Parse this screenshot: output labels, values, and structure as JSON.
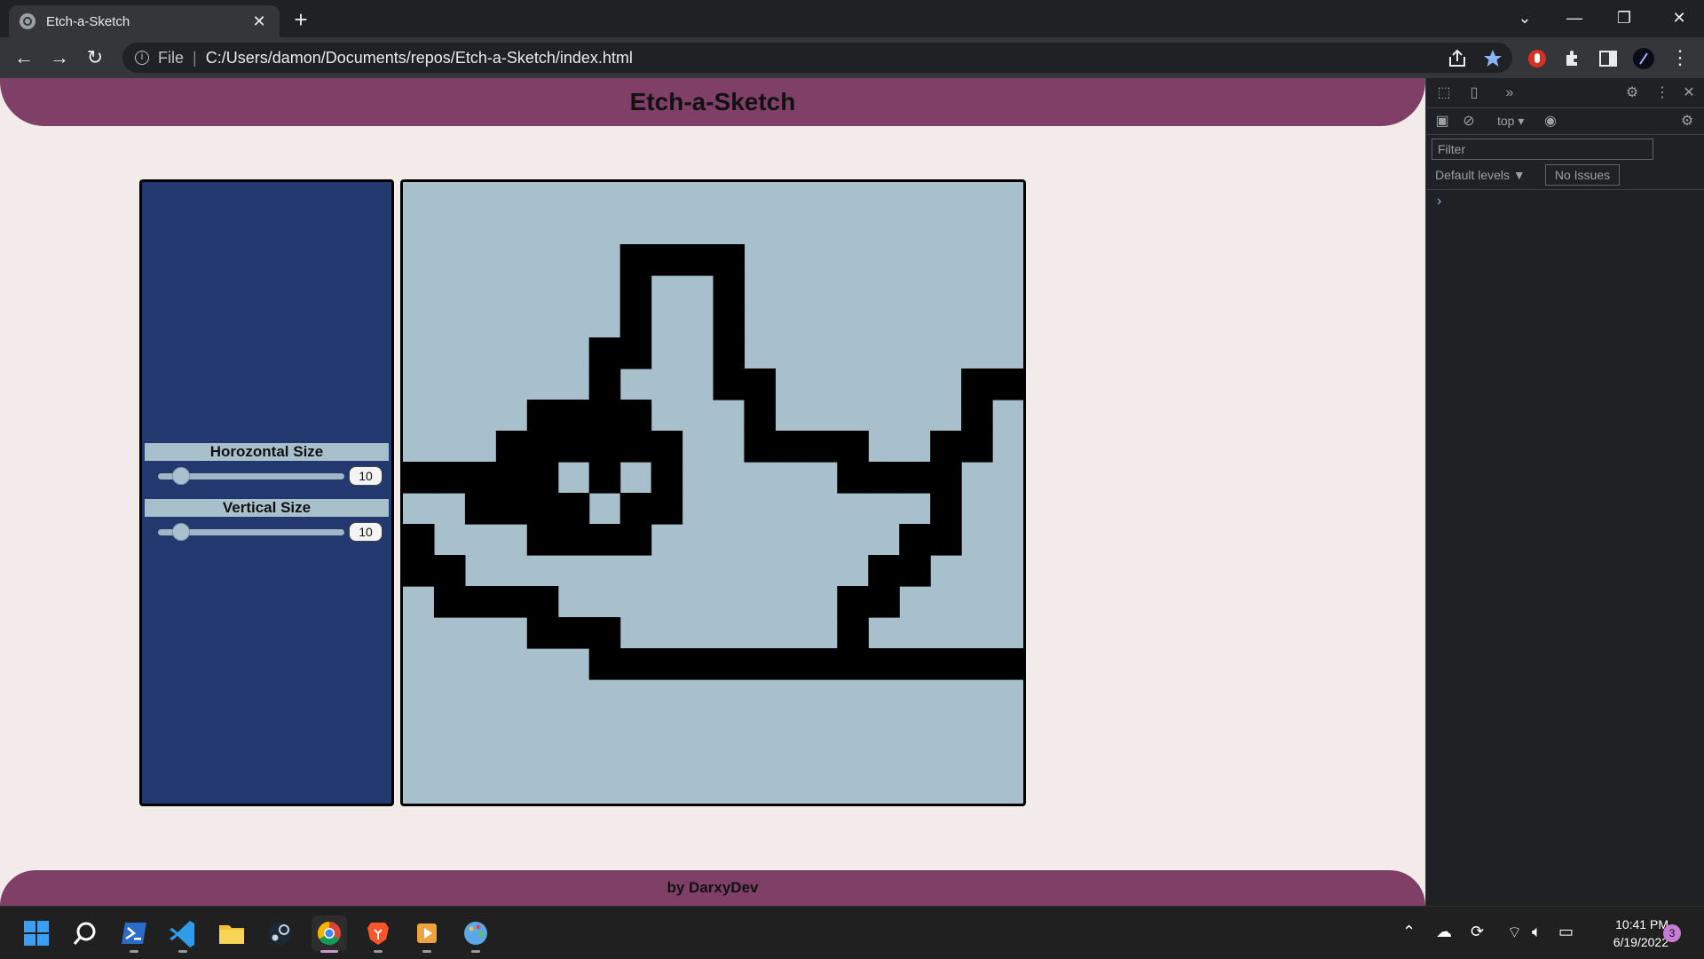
{
  "browser": {
    "tab_title": "Etch-a-Sketch",
    "url_scheme": "File",
    "url_path": "C:/Users/damon/Documents/repos/Etch-a-Sketch/index.html"
  },
  "page": {
    "title": "Etch-a-Sketch",
    "footer": "by DarxyDev",
    "controls": {
      "horizontal_label": "Horozontal Size",
      "horizontal_value": "10",
      "horizontal_fraction": 0.05,
      "vertical_label": "Vertical Size",
      "vertical_value": "10",
      "vertical_fraction": 0.05
    },
    "drawing": {
      "columns": 20,
      "rows": 20,
      "cell_color": "#000000",
      "background_color": "#a8bfcc",
      "filled_cells": [
        [
          7,
          2
        ],
        [
          8,
          2
        ],
        [
          9,
          2
        ],
        [
          10,
          2
        ],
        [
          7,
          3
        ],
        [
          10,
          3
        ],
        [
          7,
          4
        ],
        [
          10,
          4
        ],
        [
          6,
          5
        ],
        [
          7,
          5
        ],
        [
          10,
          5
        ],
        [
          6,
          6
        ],
        [
          10,
          6
        ],
        [
          11,
          6
        ],
        [
          18,
          6
        ],
        [
          19,
          6
        ],
        [
          4,
          7
        ],
        [
          5,
          7
        ],
        [
          6,
          7
        ],
        [
          7,
          7
        ],
        [
          11,
          7
        ],
        [
          18,
          7
        ],
        [
          3,
          8
        ],
        [
          4,
          8
        ],
        [
          5,
          8
        ],
        [
          6,
          8
        ],
        [
          7,
          8
        ],
        [
          8,
          8
        ],
        [
          11,
          8
        ],
        [
          12,
          8
        ],
        [
          13,
          8
        ],
        [
          14,
          8
        ],
        [
          17,
          8
        ],
        [
          18,
          8
        ],
        [
          0,
          9
        ],
        [
          1,
          9
        ],
        [
          2,
          9
        ],
        [
          3,
          9
        ],
        [
          4,
          9
        ],
        [
          6,
          9
        ],
        [
          8,
          9
        ],
        [
          14,
          9
        ],
        [
          15,
          9
        ],
        [
          16,
          9
        ],
        [
          17,
          9
        ],
        [
          2,
          10
        ],
        [
          3,
          10
        ],
        [
          4,
          10
        ],
        [
          5,
          10
        ],
        [
          7,
          10
        ],
        [
          8,
          10
        ],
        [
          17,
          10
        ],
        [
          0,
          11
        ],
        [
          4,
          11
        ],
        [
          5,
          11
        ],
        [
          6,
          11
        ],
        [
          7,
          11
        ],
        [
          16,
          11
        ],
        [
          17,
          11
        ],
        [
          0,
          12
        ],
        [
          1,
          12
        ],
        [
          15,
          12
        ],
        [
          16,
          12
        ],
        [
          1,
          13
        ],
        [
          2,
          13
        ],
        [
          3,
          13
        ],
        [
          4,
          13
        ],
        [
          14,
          13
        ],
        [
          15,
          13
        ],
        [
          4,
          14
        ],
        [
          5,
          14
        ],
        [
          6,
          14
        ],
        [
          14,
          14
        ],
        [
          6,
          15
        ],
        [
          7,
          15
        ],
        [
          8,
          15
        ],
        [
          9,
          15
        ],
        [
          10,
          15
        ],
        [
          11,
          15
        ],
        [
          12,
          15
        ],
        [
          13,
          15
        ],
        [
          14,
          15
        ],
        [
          15,
          15
        ],
        [
          16,
          15
        ],
        [
          17,
          15
        ],
        [
          18,
          15
        ],
        [
          19,
          15
        ]
      ]
    }
  },
  "devtools": {
    "context": "top",
    "filter_placeholder": "Filter",
    "levels": "Default levels ▼",
    "issues": "No Issues",
    "prompt": "›"
  },
  "taskbar": {
    "time": "10:41 PM",
    "date": "6/19/2022",
    "notifications": "3"
  }
}
